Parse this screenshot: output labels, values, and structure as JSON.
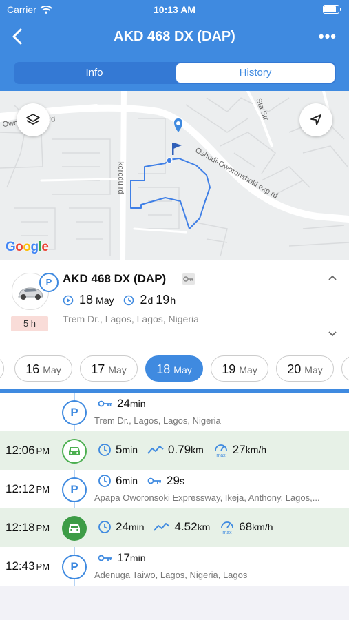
{
  "status_bar": {
    "carrier": "Carrier",
    "time": "10:13 AM"
  },
  "nav": {
    "title": "AKD 468 DX (DAP)",
    "more": "•••"
  },
  "tabs": [
    {
      "label": "Info",
      "active": false
    },
    {
      "label": "History",
      "active": true
    }
  ],
  "map": {
    "logo": "Google",
    "street_labels": [
      "Oshodi-Oworonshoki exp rd",
      "Ikorodu rd",
      "Oworonshoki rd",
      "Sta Str"
    ]
  },
  "vehicle_card": {
    "name": "AKD 468 DX (DAP)",
    "status_badge": "P",
    "duration_badge": "5 h",
    "date_day": "18",
    "date_month": "May",
    "elapsed_days": "2",
    "elapsed_days_unit": "d",
    "elapsed_hours": "19",
    "elapsed_hours_unit": "h",
    "address": "Trem Dr., Lagos, Lagos, Nigeria"
  },
  "dates": [
    {
      "day": "16",
      "month": "May",
      "selected": false
    },
    {
      "day": "17",
      "month": "May",
      "selected": false
    },
    {
      "day": "18",
      "month": "May",
      "selected": true
    },
    {
      "day": "19",
      "month": "May",
      "selected": false
    },
    {
      "day": "20",
      "month": "May",
      "selected": false
    }
  ],
  "history": [
    {
      "type": "parking",
      "time": "",
      "ampm": "",
      "duration": "24",
      "duration_unit": "min",
      "address": "Trem Dr., Lagos, Lagos, Nigeria"
    },
    {
      "type": "trip",
      "time": "12:06",
      "ampm": "PM",
      "duration": "5",
      "duration_unit": "min",
      "distance": "0.79",
      "distance_unit": "km",
      "max_speed": "27",
      "speed_unit": "km/h"
    },
    {
      "type": "parking",
      "time": "12:12",
      "ampm": "PM",
      "duration": "6",
      "duration_unit": "min",
      "ignition": "29",
      "ignition_unit": "s",
      "address": "Apapa Oworonsoki Expressway, Ikeja, Anthony, Lagos,..."
    },
    {
      "type": "trip",
      "time": "12:18",
      "ampm": "PM",
      "duration": "24",
      "duration_unit": "min",
      "distance": "4.52",
      "distance_unit": "km",
      "max_speed": "68",
      "speed_unit": "km/h"
    },
    {
      "type": "parking",
      "time": "12:43",
      "ampm": "PM",
      "duration": "17",
      "duration_unit": "min",
      "address": "Adenuga Taiwo, Lagos, Nigeria, Lagos"
    }
  ],
  "max_label": "max",
  "colors": {
    "primary": "#3f8ae0",
    "trip_row": "#e7f1e7",
    "trip_icon": "#3d9c46",
    "duration_badge": "#f9dcd8"
  }
}
